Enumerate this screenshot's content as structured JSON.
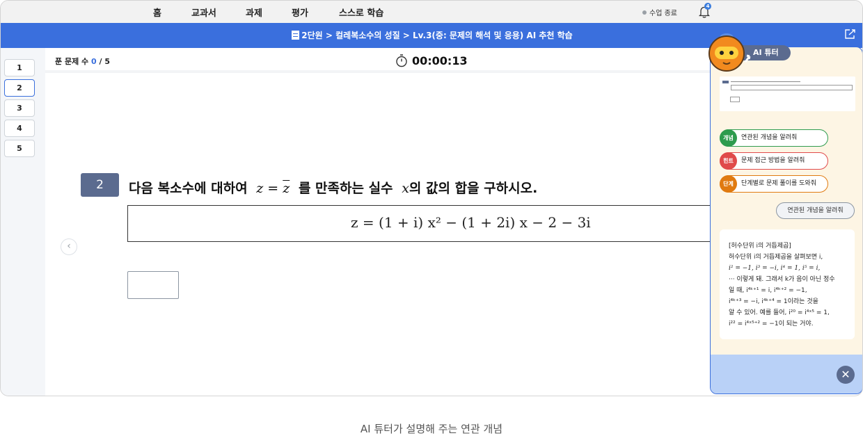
{
  "nav": {
    "items": [
      "홈",
      "교과서",
      "과제",
      "평가",
      "스스로 학습"
    ],
    "end_class": "수업 종료",
    "notification_count": "4"
  },
  "header": {
    "breadcrumb": "2단원 > 컬레복소수의 성질 > Lv.3(중: 문제의 해석 및 응용) AI 추천 학습"
  },
  "questions": [
    "1",
    "2",
    "3",
    "4",
    "5"
  ],
  "active_question": "2",
  "progress": {
    "label": "푼 문제 수",
    "solved": "0",
    "total": "/ 5"
  },
  "timer": "00:00:13",
  "problem": {
    "number": "2",
    "text_before": "다음 복소수에 대하여",
    "text_after": "를 만족하는 실수",
    "text_end": "의 값의 합을 구하시오.",
    "equation": "z = (1 + i) x² − (1 + 2i) x − 2 − 3i"
  },
  "ai_tutor": {
    "title": "AI 튜터",
    "chips": [
      {
        "tag": "개념",
        "label": "연관된 개념을 알려줘",
        "color": "#2e9b4e"
      },
      {
        "tag": "힌트",
        "label": "문제 접근 방법을 알려줘",
        "color": "#e04a4a"
      },
      {
        "tag": "단계",
        "label": "단계별로 문제 풀이를 도와줘",
        "color": "#e07a10"
      }
    ],
    "user_message": "연관된 개념을 알려줘",
    "answer": {
      "heading": "[허수단위 i의 거듭제곱]",
      "l1": "허수단위 i의 거듭제곱을 살펴보면 i,",
      "l2": "i² = −1, i³ = −i, i⁴ = 1, i⁵ = i,",
      "l3": "··· 이렇게 돼. 그래서 k가 음이 아닌 정수",
      "l4": "일 때, i⁴ᵏ⁺¹ = i, i⁴ᵏ⁺² = −1,",
      "l5": "i⁴ᵏ⁺³ = −i, i⁴ᵏ⁺⁴ = 1이라는 것을",
      "l6": "알 수 있어. 예를 들어, i²⁰ = i⁴ˣ⁵ = 1,",
      "l7": "i²² = i⁴ˣ⁵⁺² = −1이 되는 거야."
    }
  },
  "caption": "AI 튜터가 설명해 주는 연관 개념"
}
